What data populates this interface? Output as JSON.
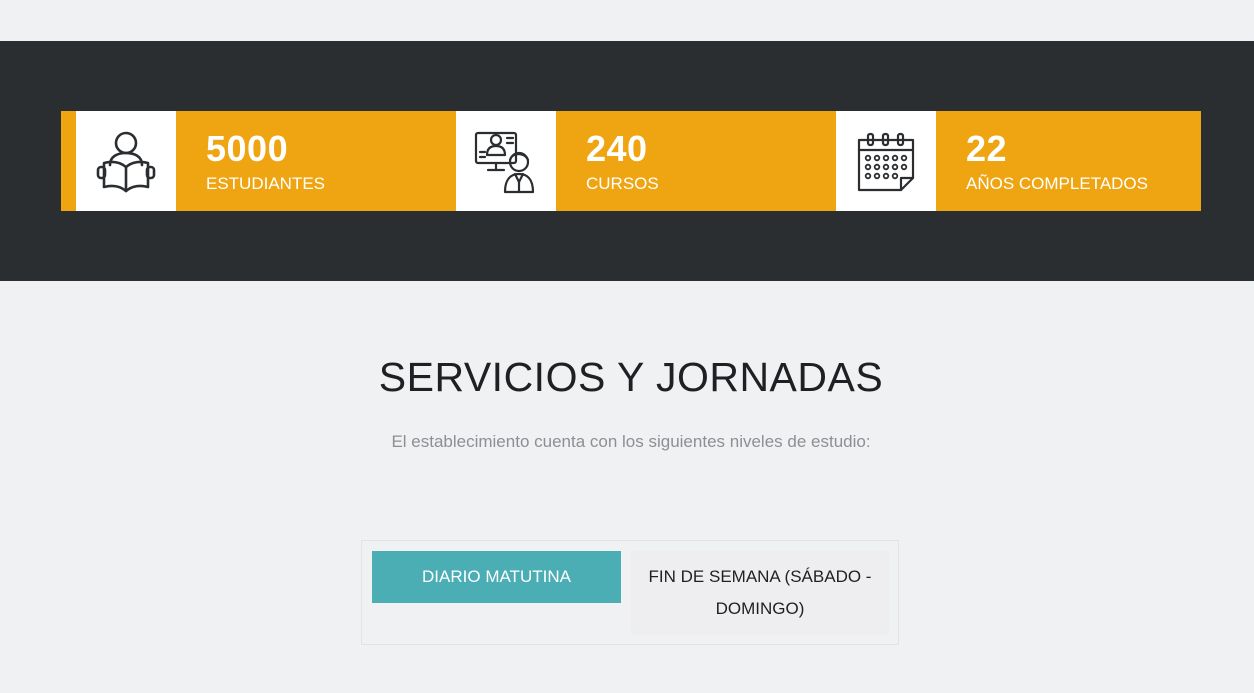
{
  "stats": [
    {
      "number": "5000",
      "label": "ESTUDIANTES",
      "icon": "reading-student-icon"
    },
    {
      "number": "240",
      "label": "CURSOS",
      "icon": "teacher-presentation-icon"
    },
    {
      "number": "22",
      "label": "AÑOS COMPLETADOS",
      "icon": "calendar-icon"
    }
  ],
  "section": {
    "title": "SERVICIOS Y JORNADAS",
    "subtitle": "El establecimiento cuenta con los siguientes niveles de estudio:"
  },
  "tabs": [
    {
      "label": "DIARIO MATUTINA",
      "active": true
    },
    {
      "label": "FIN DE SEMANA (SÁBADO - DOMINGO)",
      "active": false
    }
  ],
  "colors": {
    "band": "#2b2e31",
    "accent": "#efa511",
    "tab_active": "#4baeb5",
    "page_bg": "#f0f1f3"
  }
}
